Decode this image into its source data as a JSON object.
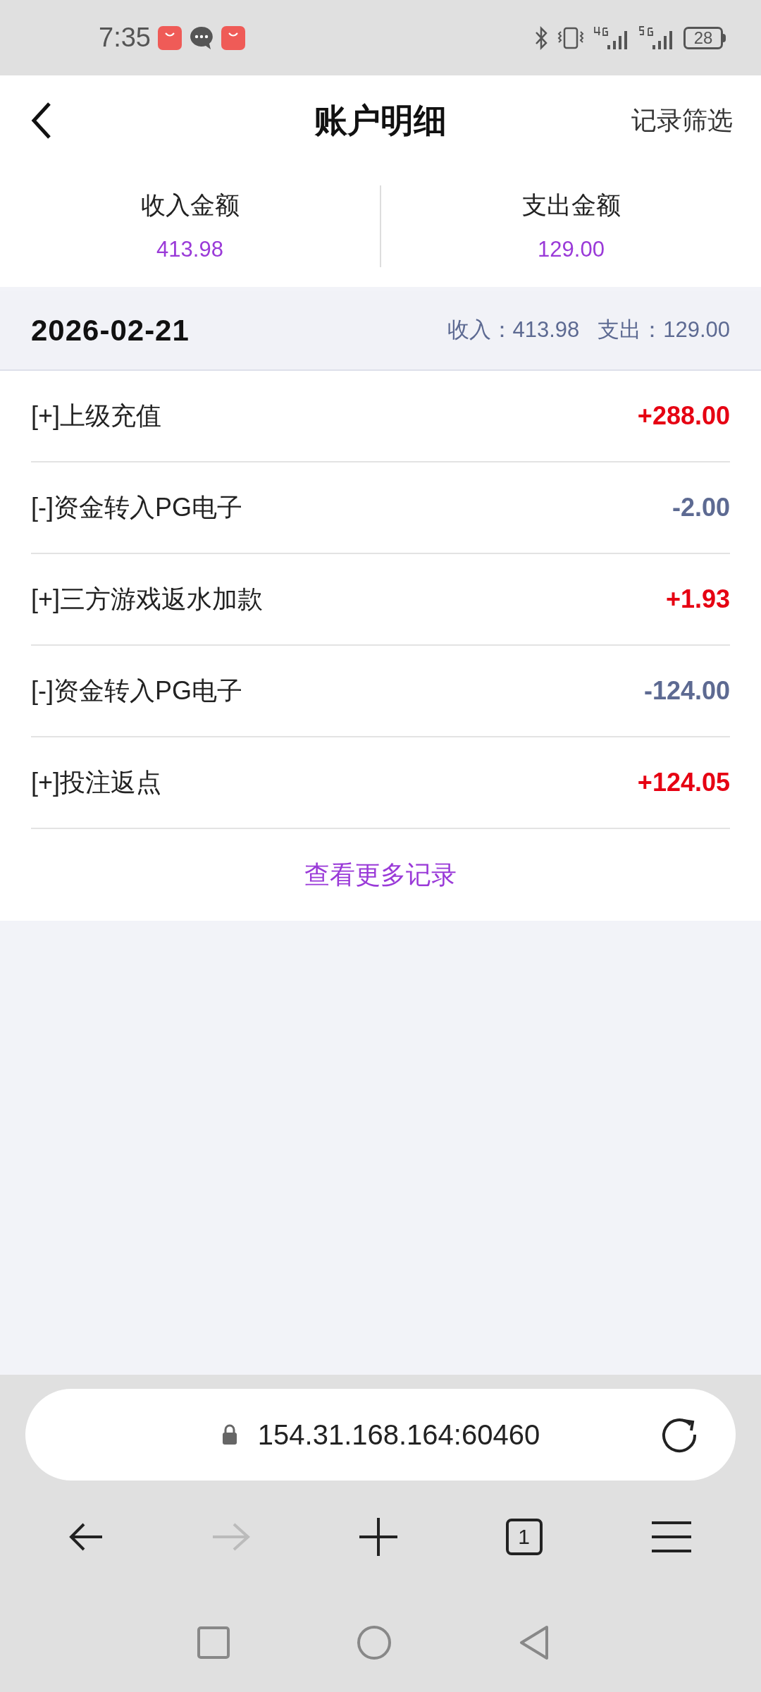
{
  "status_bar": {
    "time": "7:35",
    "battery": "28"
  },
  "header": {
    "title": "账户明细",
    "action": "记录筛选"
  },
  "summary": [
    {
      "label": "收入金额",
      "value": "413.98"
    },
    {
      "label": "支出金额",
      "value": "129.00"
    }
  ],
  "day": {
    "date": "2026-02-21",
    "totals": "收入：413.98   支出：129.00"
  },
  "records": [
    {
      "title": "[+]上级充值",
      "amount": "+288.00",
      "kind": "credit"
    },
    {
      "title": "[-]资金转入PG电子",
      "amount": "-2.00",
      "kind": "debit"
    },
    {
      "title": "[+]三方游戏返水加款",
      "amount": "+1.93",
      "kind": "credit"
    },
    {
      "title": "[-]资金转入PG电子",
      "amount": "-124.00",
      "kind": "debit"
    },
    {
      "title": "[+]投注返点",
      "amount": "+124.05",
      "kind": "credit"
    }
  ],
  "more_link": "查看更多记录",
  "browser": {
    "url": "154.31.168.164:60460",
    "tab_count": "1"
  }
}
